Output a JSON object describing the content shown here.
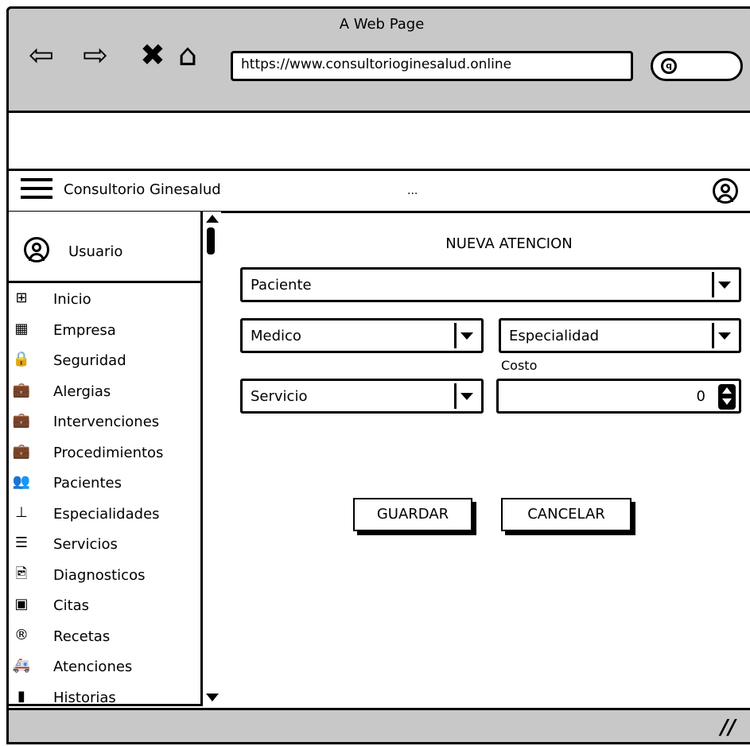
{
  "browser": {
    "page_title": "A Web Page",
    "url": "https://www.consultorioginesalud.online",
    "nav": [
      "back-icon",
      "forward-icon",
      "close-icon",
      "home-icon"
    ],
    "search_icon": "search-icon"
  },
  "appbar": {
    "title": "Consultorio Ginesalud",
    "dots": "...",
    "menu_icon": "hamburger-icon",
    "account_icon": "user-icon"
  },
  "sidebar": {
    "user_label": "Usuario",
    "items": [
      {
        "label": "Inicio",
        "icon": "windows-icon",
        "glyph": "⊞"
      },
      {
        "label": "Empresa",
        "icon": "building-icon",
        "glyph": "▦"
      },
      {
        "label": "Seguridad",
        "icon": "lock-icon",
        "glyph": "🔒"
      },
      {
        "label": "Alergias",
        "icon": "briefcase-icon",
        "glyph": "💼"
      },
      {
        "label": "Intervenciones",
        "icon": "briefcase-icon",
        "glyph": "💼"
      },
      {
        "label": "Procedimientos",
        "icon": "briefcase-icon",
        "glyph": "💼"
      },
      {
        "label": "Pacientes",
        "icon": "users-icon",
        "glyph": "👥"
      },
      {
        "label": "Especialidades",
        "icon": "sitemap-icon",
        "glyph": "⊥"
      },
      {
        "label": "Servicios",
        "icon": "server-icon",
        "glyph": "☰"
      },
      {
        "label": "Diagnosticos",
        "icon": "image-file-icon",
        "glyph": "🖻"
      },
      {
        "label": "Citas",
        "icon": "contact-card-icon",
        "glyph": "▣"
      },
      {
        "label": "Recetas",
        "icon": "registered-icon",
        "glyph": "®"
      },
      {
        "label": "Atenciones",
        "icon": "ambulance-icon",
        "glyph": "🚑"
      },
      {
        "label": "Historias",
        "icon": "file-icon",
        "glyph": "▮"
      }
    ]
  },
  "form": {
    "heading": "NUEVA ATENCION",
    "paciente": "Paciente",
    "medico": "Medico",
    "especialidad": "Especialidad",
    "costo_label": "Costo",
    "servicio": "Servicio",
    "costo_value": "0",
    "save_label": "GUARDAR",
    "cancel_label": "CANCELAR"
  },
  "colors": {
    "chrome": "#c8c8c8",
    "border": "#000000",
    "background": "#ffffff"
  }
}
